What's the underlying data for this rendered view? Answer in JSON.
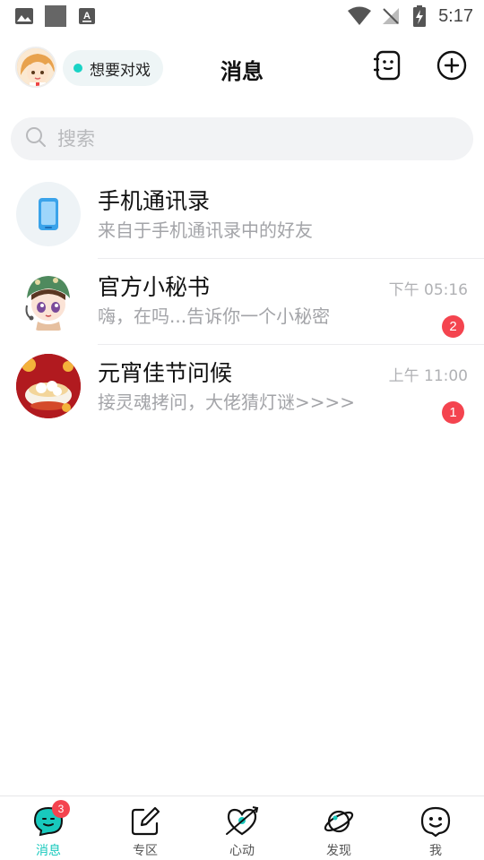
{
  "status_bar": {
    "time": "5:17",
    "left_icons": [
      "image-icon",
      "gray-square-icon",
      "accessibility-a-icon"
    ],
    "right_icons": [
      "wifi-icon",
      "no-signal-icon",
      "battery-charging-icon"
    ]
  },
  "header": {
    "title": "消息",
    "status_label": "想要对戏",
    "status_color": "#19d3c5",
    "actions": [
      "contacts-card-icon",
      "add-circle-icon"
    ]
  },
  "search": {
    "placeholder": "搜索"
  },
  "conversations": [
    {
      "name": "手机通讯录",
      "preview": "来自于手机通讯录中的好友",
      "time": "",
      "unread": ""
    },
    {
      "name": "官方小秘书",
      "preview": "嗨，在吗...告诉你一个小秘密",
      "time": "下午 05:16",
      "unread": "2"
    },
    {
      "name": "元宵佳节问候",
      "preview": "接灵魂拷问，大佬猜灯谜>>>>",
      "time": "上午 11:00",
      "unread": "1"
    }
  ],
  "bottom_nav": {
    "items": [
      {
        "label": "消息",
        "icon": "message-face-icon",
        "badge": "3",
        "active": true
      },
      {
        "label": "专区",
        "icon": "edit-square-icon",
        "badge": "",
        "active": false
      },
      {
        "label": "心动",
        "icon": "heart-arrow-icon",
        "badge": "",
        "active": false
      },
      {
        "label": "发现",
        "icon": "planet-icon",
        "badge": "",
        "active": false
      },
      {
        "label": "我",
        "icon": "smile-face-icon",
        "badge": "",
        "active": false
      }
    ]
  },
  "colors": {
    "accent": "#18c9bd",
    "badge": "#f4444f",
    "muted_text": "#a3a4a8"
  }
}
